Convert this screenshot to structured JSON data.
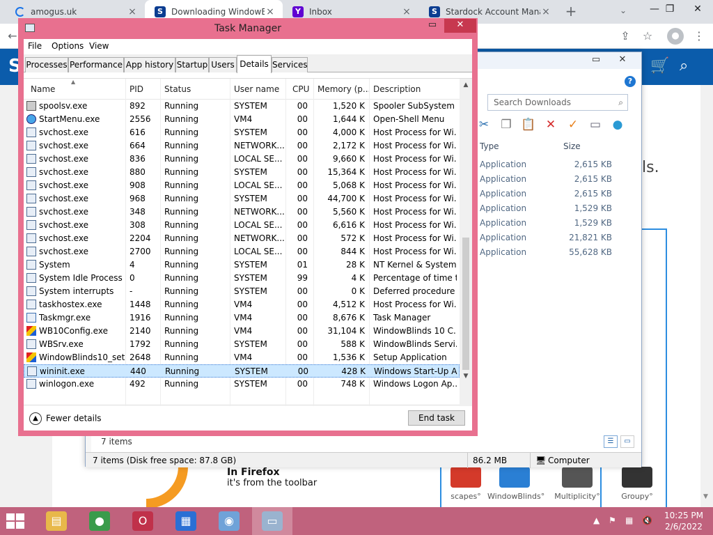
{
  "browser": {
    "tabs": [
      {
        "title": "amogus.uk",
        "icon": "loading-spinner-icon"
      },
      {
        "title": "Downloading WindowBlinds",
        "icon": "stardock-icon"
      },
      {
        "title": "Inbox",
        "icon": "yahoo-icon"
      },
      {
        "title": "Stardock Account Manager",
        "icon": "stardock-icon"
      }
    ],
    "new_tab": "+",
    "toolbar_icons": [
      "back-icon",
      "share-icon",
      "bookmark-star-icon",
      "profile-icon",
      "menu-icon"
    ]
  },
  "website": {
    "text_fragment": "ls.",
    "firefox_title": "In Firefox",
    "firefox_sub": "it's from the toolbar",
    "promos": [
      {
        "label": "scapes°",
        "color": "#d43a2a"
      },
      {
        "label": "WindowBlinds°",
        "color": "#2a7fd4"
      },
      {
        "label": "Multiplicity°",
        "color": "#555555"
      },
      {
        "label": "Groupy°",
        "color": "#333333"
      }
    ]
  },
  "downloads": {
    "search_placeholder": "Search Downloads",
    "columns": {
      "type": "Type",
      "size": "Size"
    },
    "rows": [
      {
        "type": "Application",
        "size": "2,615 KB"
      },
      {
        "type": "Application",
        "size": "2,615 KB"
      },
      {
        "type": "Application",
        "size": "2,615 KB"
      },
      {
        "type": "Application",
        "size": "1,529 KB"
      },
      {
        "type": "Application",
        "size": "1,529 KB"
      },
      {
        "type": "Application",
        "size": "21,821 KB"
      },
      {
        "type": "Application",
        "size": "55,628 KB"
      }
    ],
    "item_count": "7 items",
    "status_left": "7 items (Disk free space: 87.8 GB)",
    "status_size": "86.2 MB",
    "status_location": "Computer"
  },
  "task_manager": {
    "title": "Task Manager",
    "menu": [
      "File",
      "Options",
      "View"
    ],
    "tabs": [
      "Processes",
      "Performance",
      "App history",
      "Startup",
      "Users",
      "Details",
      "Services"
    ],
    "active_tab": "Details",
    "columns": [
      "Name",
      "PID",
      "Status",
      "User name",
      "CPU",
      "Memory (p...",
      "Description"
    ],
    "rows": [
      {
        "name": "spoolsv.exe",
        "pid": "892",
        "status": "Running",
        "user": "SYSTEM",
        "cpu": "00",
        "mem": "1,520 K",
        "desc": "Spooler SubSystem ...",
        "icon": "printer"
      },
      {
        "name": "StartMenu.exe",
        "pid": "2556",
        "status": "Running",
        "user": "VM4",
        "cpu": "00",
        "mem": "1,644 K",
        "desc": "Open-Shell Menu",
        "icon": "globe"
      },
      {
        "name": "svchost.exe",
        "pid": "616",
        "status": "Running",
        "user": "SYSTEM",
        "cpu": "00",
        "mem": "4,000 K",
        "desc": "Host Process for Wi...",
        "icon": "win"
      },
      {
        "name": "svchost.exe",
        "pid": "664",
        "status": "Running",
        "user": "NETWORK...",
        "cpu": "00",
        "mem": "2,172 K",
        "desc": "Host Process for Wi...",
        "icon": "win"
      },
      {
        "name": "svchost.exe",
        "pid": "836",
        "status": "Running",
        "user": "LOCAL SE...",
        "cpu": "00",
        "mem": "9,660 K",
        "desc": "Host Process for Wi...",
        "icon": "win"
      },
      {
        "name": "svchost.exe",
        "pid": "880",
        "status": "Running",
        "user": "SYSTEM",
        "cpu": "00",
        "mem": "15,364 K",
        "desc": "Host Process for Wi...",
        "icon": "win"
      },
      {
        "name": "svchost.exe",
        "pid": "908",
        "status": "Running",
        "user": "LOCAL SE...",
        "cpu": "00",
        "mem": "5,068 K",
        "desc": "Host Process for Wi...",
        "icon": "win"
      },
      {
        "name": "svchost.exe",
        "pid": "968",
        "status": "Running",
        "user": "SYSTEM",
        "cpu": "00",
        "mem": "44,700 K",
        "desc": "Host Process for Wi...",
        "icon": "win"
      },
      {
        "name": "svchost.exe",
        "pid": "348",
        "status": "Running",
        "user": "NETWORK...",
        "cpu": "00",
        "mem": "5,560 K",
        "desc": "Host Process for Wi...",
        "icon": "win"
      },
      {
        "name": "svchost.exe",
        "pid": "308",
        "status": "Running",
        "user": "LOCAL SE...",
        "cpu": "00",
        "mem": "6,616 K",
        "desc": "Host Process for Wi...",
        "icon": "win"
      },
      {
        "name": "svchost.exe",
        "pid": "2204",
        "status": "Running",
        "user": "NETWORK...",
        "cpu": "00",
        "mem": "572 K",
        "desc": "Host Process for Wi...",
        "icon": "win"
      },
      {
        "name": "svchost.exe",
        "pid": "2700",
        "status": "Running",
        "user": "LOCAL SE...",
        "cpu": "00",
        "mem": "844 K",
        "desc": "Host Process for Wi...",
        "icon": "win"
      },
      {
        "name": "System",
        "pid": "4",
        "status": "Running",
        "user": "SYSTEM",
        "cpu": "01",
        "mem": "28 K",
        "desc": "NT Kernel & System",
        "icon": "win"
      },
      {
        "name": "System Idle Process",
        "pid": "0",
        "status": "Running",
        "user": "SYSTEM",
        "cpu": "99",
        "mem": "4 K",
        "desc": "Percentage of time t...",
        "icon": "win"
      },
      {
        "name": "System interrupts",
        "pid": "-",
        "status": "Running",
        "user": "SYSTEM",
        "cpu": "00",
        "mem": "0 K",
        "desc": "Deferred procedure ...",
        "icon": "win"
      },
      {
        "name": "taskhostex.exe",
        "pid": "1448",
        "status": "Running",
        "user": "VM4",
        "cpu": "00",
        "mem": "4,512 K",
        "desc": "Host Process for Wi...",
        "icon": "win"
      },
      {
        "name": "Taskmgr.exe",
        "pid": "1916",
        "status": "Running",
        "user": "VM4",
        "cpu": "00",
        "mem": "8,676 K",
        "desc": "Task Manager",
        "icon": "tm"
      },
      {
        "name": "WB10Config.exe",
        "pid": "2140",
        "status": "Running",
        "user": "VM4",
        "cpu": "00",
        "mem": "31,104 K",
        "desc": "WindowBlinds 10 C...",
        "icon": "wb"
      },
      {
        "name": "WBSrv.exe",
        "pid": "1792",
        "status": "Running",
        "user": "SYSTEM",
        "cpu": "00",
        "mem": "588 K",
        "desc": "WindowBlinds Servi...",
        "icon": "win"
      },
      {
        "name": "WindowBlinds10_set...",
        "pid": "2648",
        "status": "Running",
        "user": "VM4",
        "cpu": "00",
        "mem": "1,536 K",
        "desc": "Setup Application",
        "icon": "wb"
      },
      {
        "name": "wininit.exe",
        "pid": "440",
        "status": "Running",
        "user": "SYSTEM",
        "cpu": "00",
        "mem": "428 K",
        "desc": "Windows Start-Up A...",
        "icon": "win",
        "selected": true
      },
      {
        "name": "winlogon.exe",
        "pid": "492",
        "status": "Running",
        "user": "SYSTEM",
        "cpu": "00",
        "mem": "748 K",
        "desc": "Windows Logon Ap...",
        "icon": "win"
      }
    ],
    "fewer_details": "Fewer details",
    "end_task": "End task"
  },
  "taskbar": {
    "apps": [
      {
        "name": "file-explorer",
        "color": "#e8b84a"
      },
      {
        "name": "chrome",
        "color": "#3a9b4b"
      },
      {
        "name": "opera",
        "color": "#c0314a"
      },
      {
        "name": "windowblinds",
        "color": "#2a6fd4"
      },
      {
        "name": "setup",
        "color": "#6fa2d8"
      },
      {
        "name": "task-manager",
        "color": "#9ab3cf"
      }
    ],
    "time": "10:25 PM",
    "date": "2/6/2022"
  }
}
